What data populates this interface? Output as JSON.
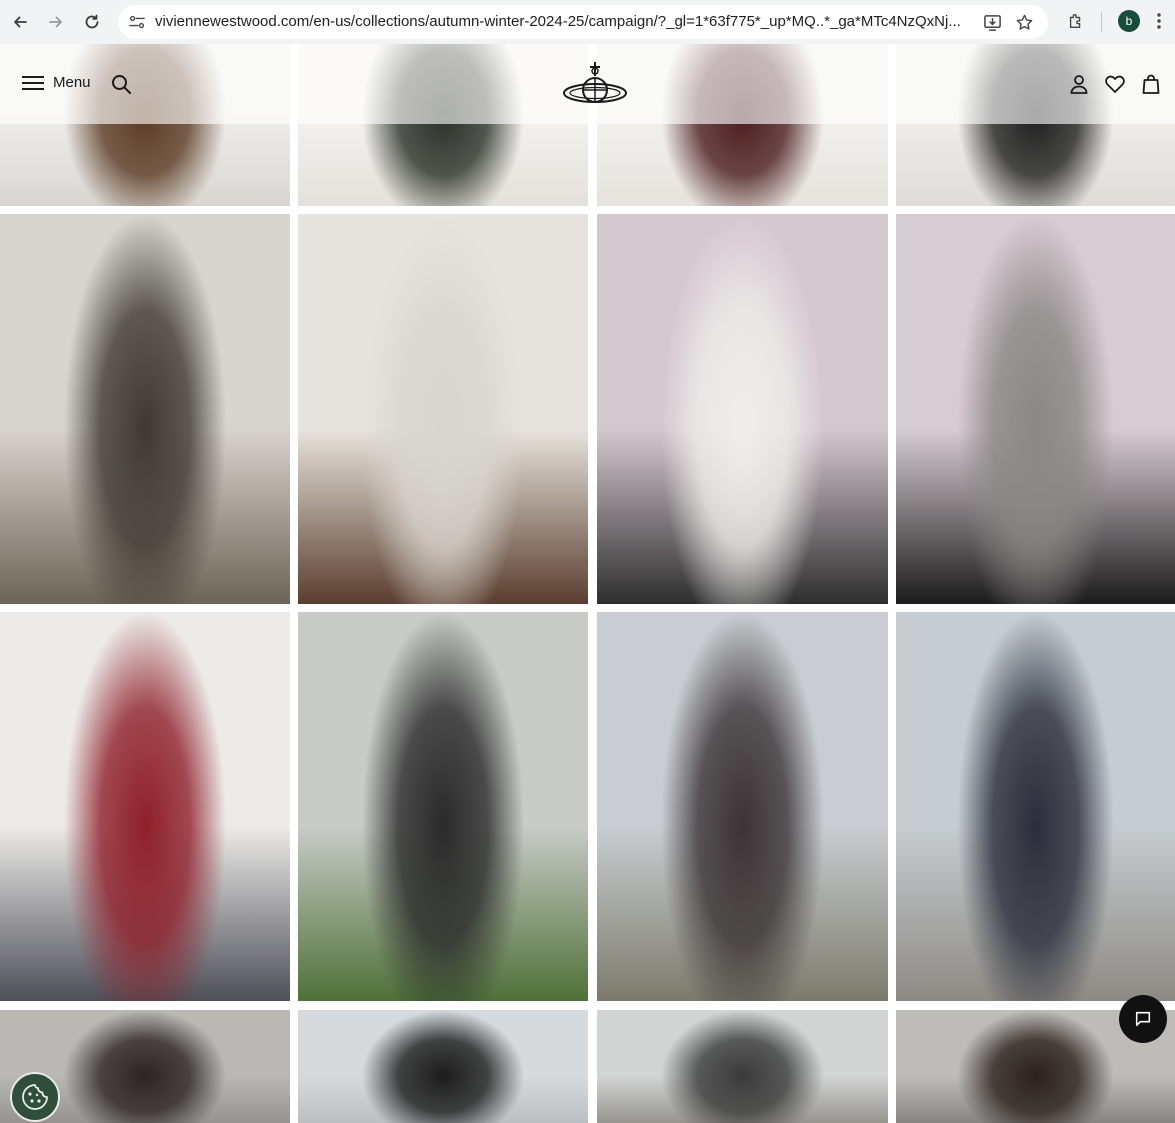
{
  "browser": {
    "url": "viviennewestwood.com/en-us/collections/autumn-winter-2024-25/campaign/?_gl=1*63f775*_up*MQ..*_ga*MTc4NzQxNj...",
    "profile_initial": "b"
  },
  "header": {
    "menu_label": "Menu"
  },
  "gallery": {
    "rows": [
      {
        "tiles": [
          {
            "alt": "campaign photo",
            "palette": [
              "#efeeec",
              "#d9d6d2",
              "#5a3a22"
            ]
          },
          {
            "alt": "campaign photo",
            "palette": [
              "#f3f2ef",
              "#e4e1dc",
              "#2b2f28"
            ]
          },
          {
            "alt": "campaign photo",
            "palette": [
              "#f2f1ee",
              "#e6e3de",
              "#4a1c1e"
            ]
          },
          {
            "alt": "campaign photo",
            "palette": [
              "#f0efec",
              "#dfdcd8",
              "#1f1f1f"
            ]
          }
        ]
      },
      {
        "tiles": [
          {
            "alt": "campaign photo",
            "palette": [
              "#d8d4ce",
              "#6b6558",
              "#3e3a33"
            ]
          },
          {
            "alt": "campaign photo",
            "palette": [
              "#e7e4dd",
              "#5a3e30",
              "#d9d6d0"
            ]
          },
          {
            "alt": "campaign photo",
            "palette": [
              "#d4c8cf",
              "#2e2e2e",
              "#efeeec"
            ]
          },
          {
            "alt": "campaign photo",
            "palette": [
              "#d7ccd2",
              "#1c1c1c",
              "#8a8786"
            ]
          }
        ]
      },
      {
        "tiles": [
          {
            "alt": "campaign photo",
            "palette": [
              "#ecebe8",
              "#4e4f58",
              "#8e1f2b"
            ]
          },
          {
            "alt": "campaign photo",
            "palette": [
              "#c8cbc8",
              "#4f7038",
              "#2a2a2a"
            ]
          },
          {
            "alt": "campaign photo",
            "palette": [
              "#c9cdd1",
              "#7b7a6c",
              "#3b3436"
            ]
          },
          {
            "alt": "campaign photo",
            "palette": [
              "#c7ccd0",
              "#8d8a84",
              "#2b2e3a"
            ]
          }
        ]
      },
      {
        "tiles": [
          {
            "alt": "campaign photo",
            "palette": [
              "#b9b8b5",
              "#8f8e8b",
              "#2c2523"
            ]
          },
          {
            "alt": "campaign photo",
            "palette": [
              "#d7dadc",
              "#b8bbbd",
              "#1c1c1c"
            ]
          },
          {
            "alt": "campaign photo",
            "palette": [
              "#d2d4d4",
              "#8c8a84",
              "#3a3a3a"
            ]
          },
          {
            "alt": "campaign photo",
            "palette": [
              "#bdbcb9",
              "#7d7c79",
              "#2a211d"
            ]
          }
        ]
      }
    ]
  }
}
